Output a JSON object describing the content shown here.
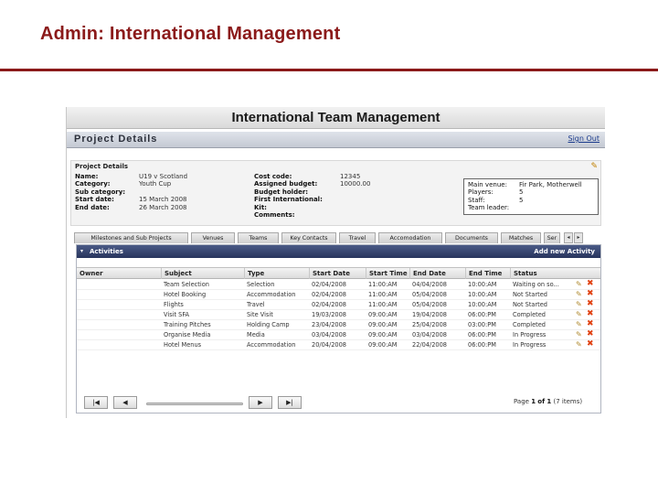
{
  "slide": {
    "title": "Admin: International Management"
  },
  "app": {
    "title": "International Team Management"
  },
  "project_bar": {
    "title": "Project Details",
    "sign_out": "Sign Out"
  },
  "details": {
    "heading": "Project Details",
    "left": [
      {
        "label": "Name:",
        "value": "U19 v Scotland"
      },
      {
        "label": "Category:",
        "value": "Youth Cup"
      },
      {
        "label": "Sub category:",
        "value": ""
      },
      {
        "label": "Start date:",
        "value": "15 March 2008"
      },
      {
        "label": "End date:",
        "value": "26 March 2008"
      }
    ],
    "middle": [
      {
        "label": "Cost code:",
        "value": "12345"
      },
      {
        "label": "Assigned budget:",
        "value": "10000.00"
      },
      {
        "label": "Budget holder:",
        "value": ""
      },
      {
        "label": "First International:",
        "value": ""
      },
      {
        "label": "Kit:",
        "value": ""
      },
      {
        "label": "Comments:",
        "value": ""
      }
    ],
    "venue": [
      {
        "label": "Main venue:",
        "value": "Fir Park, Motherwell"
      },
      {
        "label": "Players:",
        "value": "5"
      },
      {
        "label": "Staff:",
        "value": "5"
      },
      {
        "label": "Team leader:",
        "value": ""
      }
    ]
  },
  "tabs": [
    {
      "label": "Milestones and Sub Projects"
    },
    {
      "label": "Venues"
    },
    {
      "label": "Teams"
    },
    {
      "label": "Key Contacts"
    },
    {
      "label": "Travel"
    },
    {
      "label": "Accomodation"
    },
    {
      "label": "Documents"
    },
    {
      "label": "Matches"
    },
    {
      "label": "Ser"
    }
  ],
  "tab_nav": {
    "prev": "◂",
    "next": "▸"
  },
  "activities": {
    "toggle_icon": "▾",
    "title": "Activities",
    "add_label": "Add new Activity",
    "columns": [
      "Owner",
      "Subject",
      "Type",
      "Start Date",
      "Start Time",
      "End Date",
      "End Time",
      "Status"
    ],
    "rows": [
      [
        "",
        "Team Selection",
        "Selection",
        "02/04/2008",
        "11:00:AM",
        "04/04/2008",
        "10:00:AM",
        "Waiting on so..."
      ],
      [
        "",
        "Hotel Booking",
        "Accommodation",
        "02/04/2008",
        "11:00:AM",
        "05/04/2008",
        "10:00:AM",
        "Not Started"
      ],
      [
        "",
        "Flights",
        "Travel",
        "02/04/2008",
        "11:00:AM",
        "05/04/2008",
        "10:00:AM",
        "Not Started"
      ],
      [
        "",
        "Visit SFA",
        "Site Visit",
        "19/03/2008",
        "09:00:AM",
        "19/04/2008",
        "06:00:PM",
        "Completed"
      ],
      [
        "",
        "Training Pitches",
        "Holding Camp",
        "23/04/2008",
        "09:00:AM",
        "25/04/2008",
        "03:00:PM",
        "Completed"
      ],
      [
        "",
        "Organise Media",
        "Media",
        "03/04/2008",
        "09:00:AM",
        "03/04/2008",
        "06:00:PM",
        "In Progress"
      ],
      [
        "",
        "Hotel Menus",
        "Accommodation",
        "20/04/2008",
        "09:00:AM",
        "22/04/2008",
        "06:00:PM",
        "In Progress"
      ]
    ],
    "edit_icon": "✎",
    "delete_icon": "✖"
  },
  "pager": {
    "first": "|◀",
    "prev": "◀",
    "next": "▶",
    "last": "▶|",
    "page_label": "Page",
    "page_current": "1",
    "of_label": "of",
    "page_total": "1",
    "items_note": "(7 items)"
  }
}
